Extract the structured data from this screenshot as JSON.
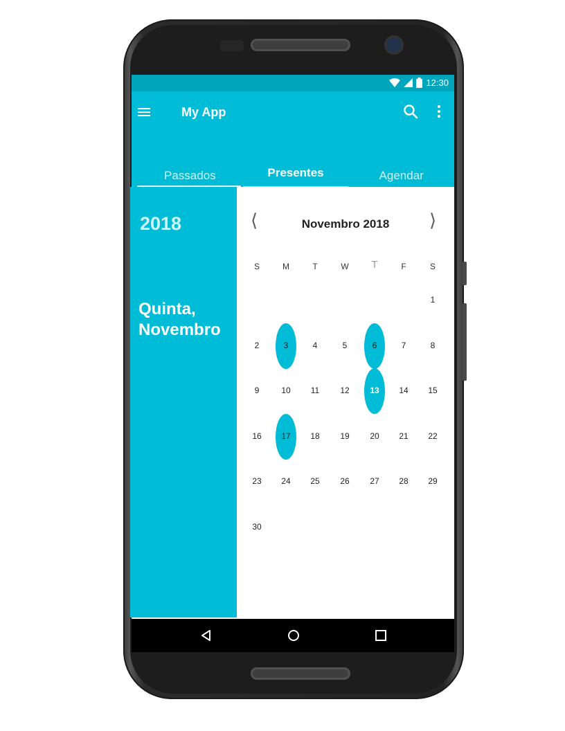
{
  "status_bar": {
    "time": "12:30"
  },
  "app_bar": {
    "title": "My App"
  },
  "tabs": [
    {
      "label": "Passados"
    },
    {
      "label": "Presentes"
    },
    {
      "label": "Agendar"
    }
  ],
  "side_panel": {
    "year": "2018",
    "date_line1": "Quinta,",
    "date_line2": "Novembro"
  },
  "calendar": {
    "title": "Novembro 2018",
    "prev": "⟨",
    "next": "⟩",
    "weekdays": [
      "S",
      "M",
      "T",
      "W",
      "T",
      "F",
      "S"
    ],
    "days": [
      "1",
      "2",
      "3",
      "4",
      "5",
      "6",
      "7",
      "8",
      "9",
      "10",
      "11",
      "12",
      "13",
      "14",
      "15",
      "16",
      "17",
      "18",
      "19",
      "20",
      "21",
      "22",
      "23",
      "24",
      "25",
      "26",
      "27",
      "28",
      "29",
      "30"
    ],
    "highlighted_days": [
      "3",
      "6",
      "13",
      "17"
    ],
    "selected_day": "13"
  },
  "colors": {
    "primary": "#00bcd6",
    "status_bar": "#00a5bb",
    "tab_indicator": "#d4e98c"
  },
  "icons": [
    "menu-icon",
    "search-icon",
    "more-vert-icon",
    "wifi-icon",
    "signal-icon",
    "battery-icon",
    "back-icon",
    "home-icon",
    "recents-icon"
  ]
}
